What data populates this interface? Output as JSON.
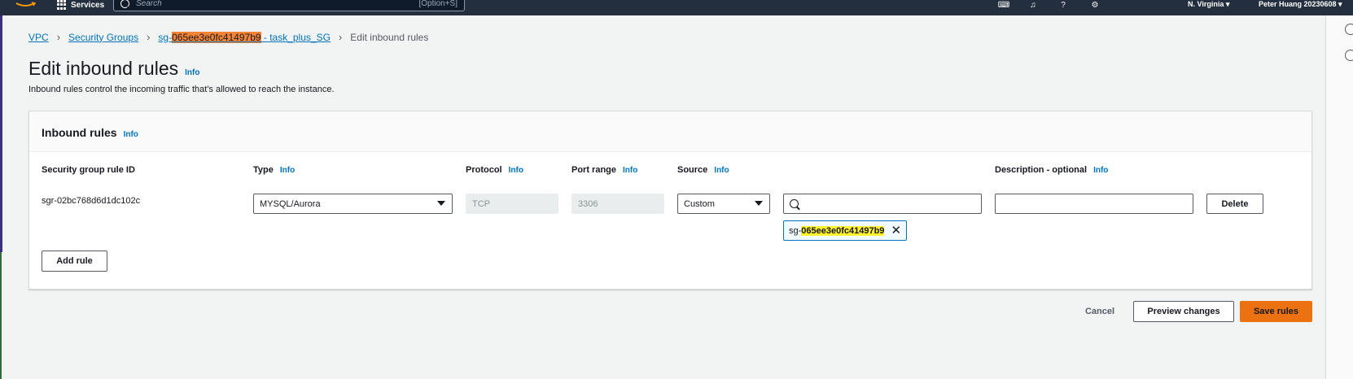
{
  "topnav": {
    "services_label": "Services",
    "search_placeholder": "Search",
    "search_shortcut": "[Option+S]",
    "region": "N. Virginia ▾",
    "user": "Peter Huang 20230608 ▾"
  },
  "breadcrumb": {
    "vpc": "VPC",
    "security_groups": "Security Groups",
    "sg_prefix": "sg-",
    "sg_id_highlight": "065ee3e0fc41497b9",
    "sg_suffix": " - task_plus_SG",
    "current": "Edit inbound rules"
  },
  "page": {
    "title": "Edit inbound rules",
    "info": "Info",
    "description": "Inbound rules control the incoming traffic that's allowed to reach the instance."
  },
  "panel": {
    "title": "Inbound rules",
    "info": "Info",
    "columns": {
      "rule_id": "Security group rule ID",
      "type": "Type",
      "protocol": "Protocol",
      "port_range": "Port range",
      "source": "Source",
      "description": "Description - optional"
    },
    "info_label": "Info",
    "rule": {
      "id": "sgr-02bc768d6d1dc102c",
      "type": "MYSQL/Aurora",
      "protocol": "TCP",
      "port_range": "3306",
      "source_mode": "Custom",
      "source_search": "",
      "description": "",
      "token_prefix": "sg-",
      "token_highlight": "065ee3e0fc41497b9",
      "delete_label": "Delete"
    },
    "add_rule_label": "Add rule"
  },
  "footer": {
    "cancel": "Cancel",
    "preview": "Preview changes",
    "save": "Save rules"
  },
  "colors": {
    "nav_bg": "#232f3e",
    "link": "#0073bb",
    "primary": "#ec7211",
    "highlight_orange": "#f58536",
    "highlight_yellow": "#fff030"
  }
}
